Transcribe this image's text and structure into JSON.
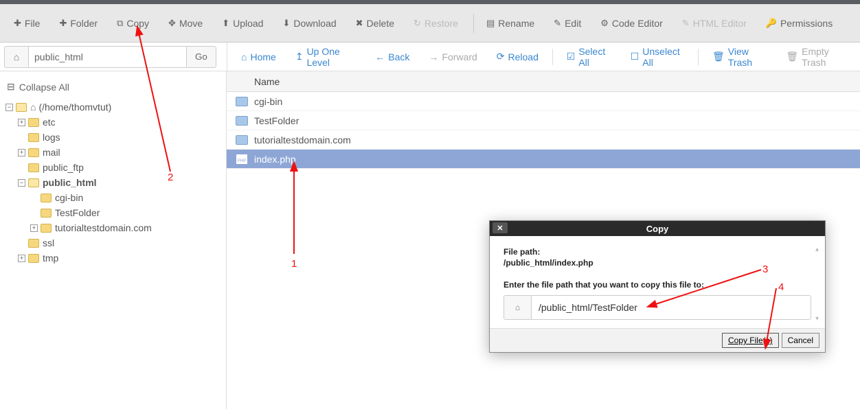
{
  "toolbar": {
    "file": "File",
    "folder": "Folder",
    "copy": "Copy",
    "move": "Move",
    "upload": "Upload",
    "download": "Download",
    "delete": "Delete",
    "restore": "Restore",
    "rename": "Rename",
    "edit": "Edit",
    "code_editor": "Code Editor",
    "html_editor": "HTML Editor",
    "permissions": "Permissions"
  },
  "subbar": {
    "path_value": "public_html",
    "go": "Go",
    "home": "Home",
    "up": "Up One Level",
    "back": "Back",
    "forward": "Forward",
    "reload": "Reload",
    "select_all": "Select All",
    "unselect_all": "Unselect All",
    "view_trash": "View Trash",
    "empty_trash": "Empty Trash"
  },
  "sidebar": {
    "collapse": "Collapse All",
    "root": "(/home/thomvtut)",
    "nodes": {
      "etc": "etc",
      "logs": "logs",
      "mail": "mail",
      "public_ftp": "public_ftp",
      "public_html": "public_html",
      "cgi_bin": "cgi-bin",
      "testfolder": "TestFolder",
      "tutorial": "tutorialtestdomain.com",
      "ssl": "ssl",
      "tmp": "tmp"
    }
  },
  "table": {
    "header_name": "Name",
    "rows": {
      "r0": "cgi-bin",
      "r1": "TestFolder",
      "r2": "tutorialtestdomain.com",
      "r3": "index.php"
    }
  },
  "dialog": {
    "title": "Copy",
    "file_path_label": "File path:",
    "file_path_value": "/public_html/index.php",
    "instruction": "Enter the file path that you want to copy this file to:",
    "dest_value": "/public_html/TestFolder",
    "copy_btn": "Copy File(s)",
    "cancel_btn": "Cancel"
  },
  "annotations": {
    "a1": "1",
    "a2": "2",
    "a3": "3",
    "a4": "4"
  }
}
